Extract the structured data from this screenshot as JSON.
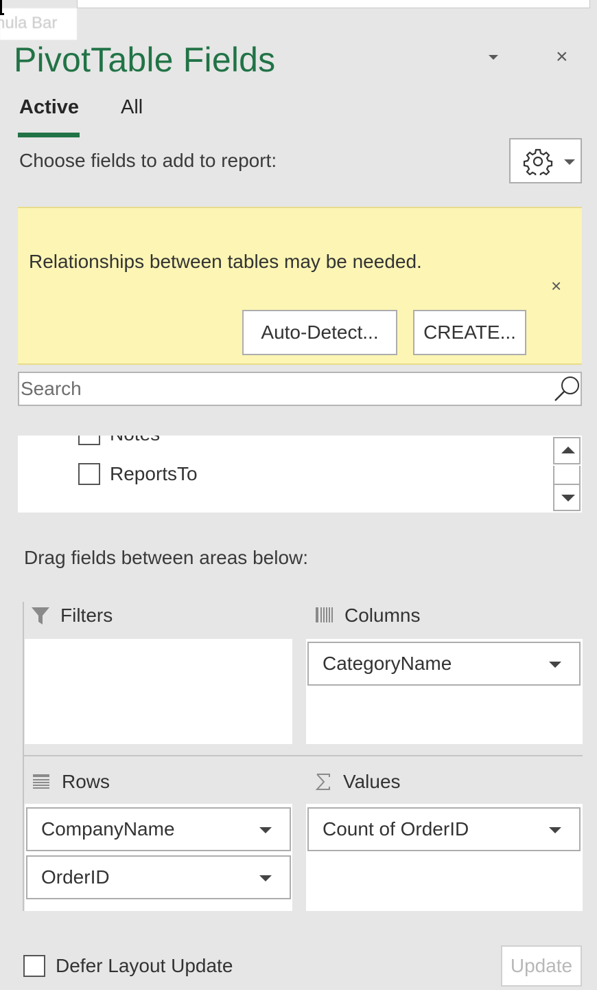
{
  "formula_bar": {
    "tooltip": "nula Bar"
  },
  "panel": {
    "title": "PivotTable Fields",
    "title_color": "#217346",
    "tabs": [
      {
        "label": "Active",
        "active": true
      },
      {
        "label": "All",
        "active": false
      }
    ],
    "choose_label": "Choose fields to add to report:",
    "tools_icon": "gear-icon"
  },
  "notice": {
    "message": "Relationships between tables may be needed.",
    "close_symbol": "×",
    "buttons": {
      "auto_detect": "Auto-Detect...",
      "create": "CREATE..."
    },
    "background": "#fcf5b4"
  },
  "search": {
    "placeholder": "Search",
    "value": ""
  },
  "field_list": {
    "items": [
      {
        "label": "Notes",
        "checked": false
      },
      {
        "label": "ReportsTo",
        "checked": false
      }
    ]
  },
  "areas": {
    "drag_label": "Drag fields between areas below:",
    "filters": {
      "label": "Filters",
      "fields": []
    },
    "columns": {
      "label": "Columns",
      "fields": [
        "CategoryName"
      ]
    },
    "rows": {
      "label": "Rows",
      "fields": [
        "CompanyName",
        "OrderID"
      ]
    },
    "values": {
      "label": "Values",
      "fields": [
        "Count of OrderID"
      ]
    }
  },
  "footer": {
    "defer_label": "Defer Layout Update",
    "defer_checked": false,
    "update_label": "Update"
  },
  "symbols": {
    "close": "×"
  }
}
